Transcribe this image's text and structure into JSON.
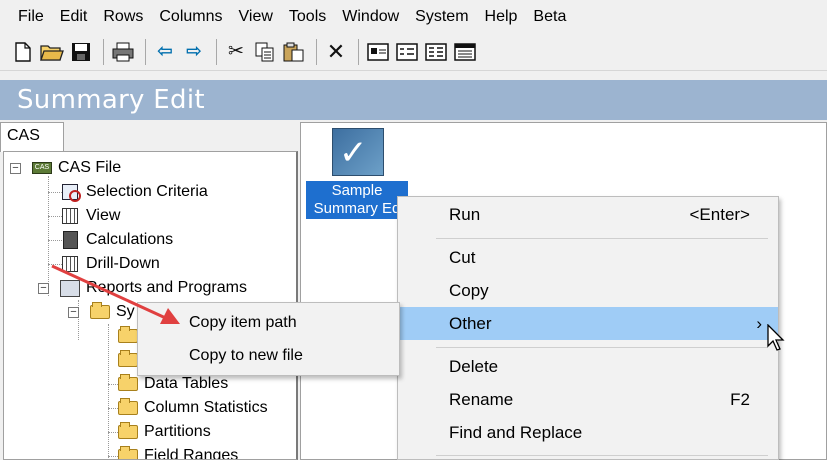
{
  "menubar": {
    "items": [
      "File",
      "Edit",
      "Rows",
      "Columns",
      "View",
      "Tools",
      "Window",
      "System",
      "Help",
      "Beta"
    ]
  },
  "toolbar": {
    "buttons": [
      "new-icon",
      "open-icon",
      "save-icon",
      "print-icon",
      "back-icon",
      "forward-icon",
      "cut-icon",
      "copy-icon",
      "paste-icon",
      "delete-icon",
      "view-large-icon",
      "view-small-icon",
      "view-list-icon",
      "view-details-icon"
    ]
  },
  "title_band": {
    "title": "Summary Edit"
  },
  "tab": {
    "label": "CAS"
  },
  "tree": {
    "items": [
      "CAS File",
      "Selection Criteria",
      "View",
      "Calculations",
      "Drill-Down",
      "Reports and Programs",
      "Sy",
      "Data Tables",
      "Column Statistics",
      "Partitions",
      "Field Ranges"
    ]
  },
  "main": {
    "file_item": {
      "line1": "Sample",
      "line2": "Summary Ed"
    }
  },
  "context_menu": {
    "run": "Run",
    "run_shortcut": "<Enter>",
    "cut": "Cut",
    "copy": "Copy",
    "other": "Other",
    "other_arrow": "›",
    "delete": "Delete",
    "rename": "Rename",
    "rename_shortcut": "F2",
    "find_replace": "Find and Replace"
  },
  "submenu": {
    "copy_item_path": "Copy item path",
    "copy_to_new_file": "Copy to new file"
  },
  "colors": {
    "title_band": "#9cb4d0",
    "selection": "#1e6fcf",
    "menu_highlight": "#9fccf6",
    "annotation_arrow": "#e04040"
  }
}
